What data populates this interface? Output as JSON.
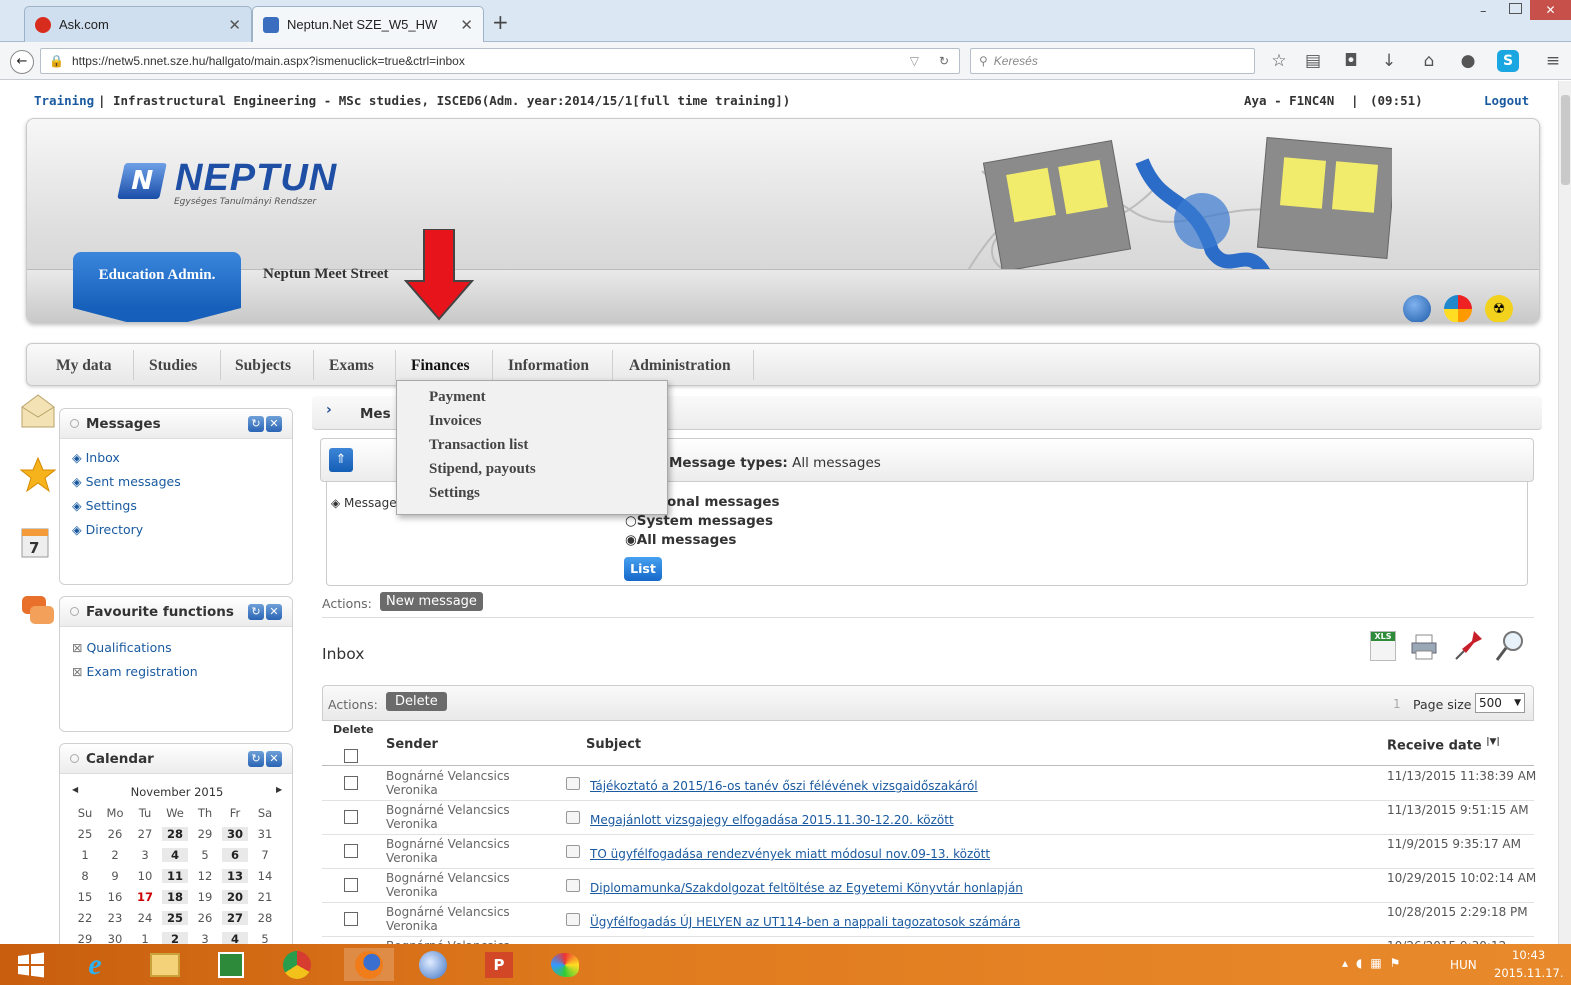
{
  "browser": {
    "tabs": [
      {
        "title": "Ask.com",
        "active": false
      },
      {
        "title": "Neptun.Net SZE_W5_HW",
        "active": true
      }
    ],
    "new_tab": "+",
    "url": "https://netw5.nnet.sze.hu/hallgato/main.aspx?ismenuclick=true&ctrl=inbox",
    "search_placeholder": "Keresés"
  },
  "topinfo": {
    "training_link": "Training",
    "separator": "|",
    "program": "Infrastructural Engineering - MSc studies, ISCED6(Adm. year:2014/15/1[full time training])",
    "user": "Aya - F1NC4N",
    "timer": "(09:51)",
    "logout": "Logout"
  },
  "header": {
    "logo_text": "NEPTUN",
    "logo_sub": "Egységes Tanulmányi Rendszer",
    "tab_active": "Education Admin.",
    "tab_other": "Neptun Meet Street"
  },
  "menu": {
    "items": [
      "My data",
      "Studies",
      "Subjects",
      "Exams",
      "Finances",
      "Information",
      "Administration"
    ],
    "finances_dropdown": [
      "Payment",
      "Invoices",
      "Transaction list",
      "Stipend, payouts",
      "Settings"
    ]
  },
  "sidebar": {
    "messages": {
      "title": "Messages",
      "items": [
        "Inbox",
        "Sent messages",
        "Settings",
        "Directory"
      ]
    },
    "favourites": {
      "title": "Favourite functions",
      "items": [
        "Qualifications",
        "Exam registration"
      ]
    },
    "calendar": {
      "title": "Calendar",
      "month": "November 2015",
      "prev": "◀",
      "next": "▶",
      "weekdays": [
        "Su",
        "Mo",
        "Tu",
        "We",
        "Th",
        "Fr",
        "Sa"
      ],
      "weeks": [
        [
          "25",
          "26",
          "27",
          "28",
          "29",
          "30",
          "31"
        ],
        [
          "1",
          "2",
          "3",
          "4",
          "5",
          "6",
          "7"
        ],
        [
          "8",
          "9",
          "10",
          "11",
          "12",
          "13",
          "14"
        ],
        [
          "15",
          "16",
          "17",
          "18",
          "19",
          "20",
          "21"
        ],
        [
          "22",
          "23",
          "24",
          "25",
          "26",
          "27",
          "28"
        ],
        [
          "29",
          "30",
          "1",
          "2",
          "3",
          "4",
          "5"
        ]
      ],
      "side_day": "7"
    }
  },
  "main": {
    "section_title": "Mes",
    "filter": {
      "message_types_label": "Message types:",
      "message_types_value": "All messages",
      "left_label": "Message",
      "options": [
        "onal messages",
        "System messages",
        "All messages"
      ],
      "selected": "All messages",
      "list_button": "List"
    },
    "actions_label": "Actions:",
    "new_message": "New message",
    "inbox_title": "Inbox",
    "table": {
      "actions_label": "Actions:",
      "delete_button": "Delete",
      "page_num": "1",
      "page_size_label": "Page size",
      "page_size_value": "500",
      "col_delete": "Delete",
      "col_sender": "Sender",
      "col_subject": "Subject",
      "col_date": "Receive date",
      "rows": [
        {
          "sender": "Bognárné Velancsics Veronika",
          "subject": "Tájékoztató a 2015/16-os tanév őszi félévének vizsgaidőszakáról",
          "date": "11/13/2015 11:38:39 AM"
        },
        {
          "sender": "Bognárné Velancsics Veronika",
          "subject": "Megajánlott vizsgajegy elfogadása 2015.11.30-12.20. között",
          "date": "11/13/2015 9:51:15 AM"
        },
        {
          "sender": "Bognárné Velancsics Veronika",
          "subject": "TO ügyfélfogadása rendezvények miatt módosul nov.09-13. között",
          "date": "11/9/2015 9:35:17 AM"
        },
        {
          "sender": "Bognárné Velancsics Veronika",
          "subject": "Diplomamunka/Szakdolgozat feltöltése az Egyetemi Könyvtár honlapján",
          "date": "10/29/2015 10:02:14 AM"
        },
        {
          "sender": "Bognárné Velancsics Veronika",
          "subject": "Ügyfélfogadás ÚJ HELYEN az UT114-ben a nappali tagozatosok számára",
          "date": "10/28/2015 2:29:18 PM"
        },
        {
          "sender": "Bognárné Velancsics",
          "subject": "",
          "date": "10/26/2015 9:30:12"
        }
      ]
    }
  },
  "taskbar": {
    "lang": "HUN",
    "time": "10:43",
    "date": "2015.11.17."
  },
  "colors": {
    "accent": "#2a64b4",
    "arrow": "#e8141b",
    "taskbar": "#d9711c"
  }
}
